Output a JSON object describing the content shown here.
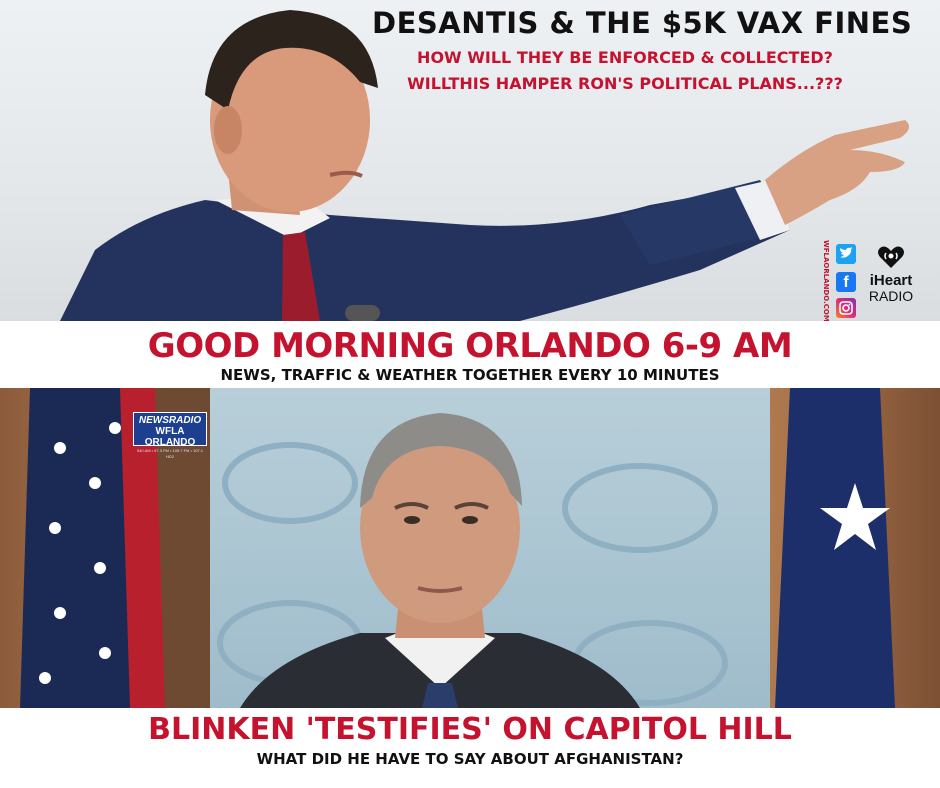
{
  "top_story": {
    "headline": "DESANTIS & THE $5K VAX FINES",
    "subline_1": "HOW WILL THEY BE ENFORCED & COLLECTED?",
    "subline_2": "WILLTHIS HAMPER RON'S POLITICAL PLANS...???"
  },
  "social": {
    "site": "WFLAORLANDO.COM",
    "icons": [
      "twitter-icon",
      "facebook-icon",
      "instagram-icon"
    ],
    "brand_name": "iHeart",
    "brand_sub": "RADIO"
  },
  "show": {
    "title": "GOOD MORNING ORLANDO 6-9 AM",
    "tagline": "NEWS, TRAFFIC & WEATHER TOGETHER EVERY 10 MINUTES"
  },
  "badge": {
    "line1": "NEWSRADIO",
    "line2": "WFLA ORLANDO",
    "line3": "540 AM • 97.3 FM • 105.7 FM • 107.1 HD2"
  },
  "bottom_story": {
    "headline": "BLINKEN 'TESTIFIES' ON CAPITOL HILL",
    "subline": "WHAT DID HE HAVE TO SAY ABOUT AFGHANISTAN?"
  },
  "colors": {
    "accent_red": "#c4122f",
    "text_dark": "#111111",
    "suit_navy": "#1f2f57",
    "wall_blue": "#a9c4d2"
  }
}
